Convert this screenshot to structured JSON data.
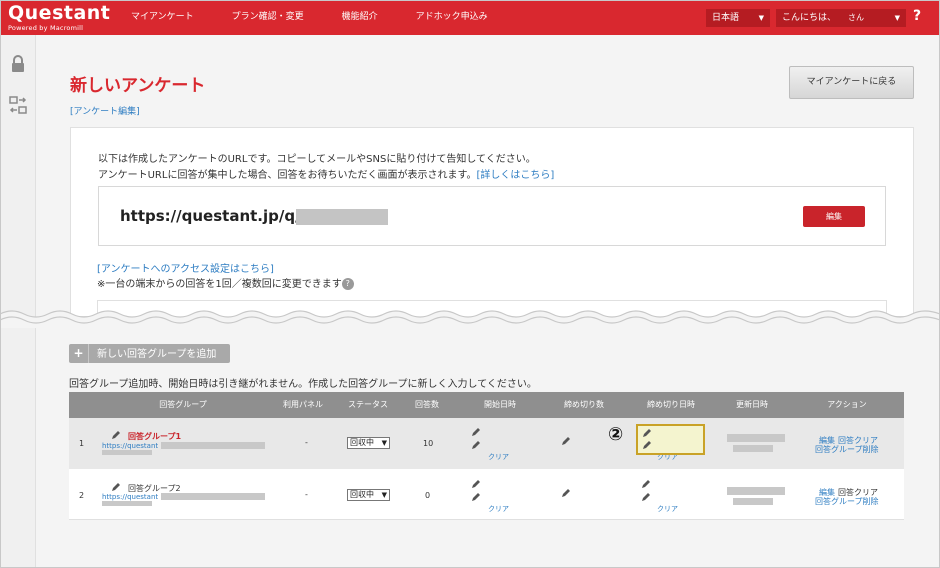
{
  "header": {
    "logo": "Questant",
    "logo_sub": "Powered by Macromill",
    "nav": [
      "マイアンケート",
      "プラン確認・変更",
      "機能紹介",
      "アドホック申込み"
    ],
    "language": "日本語",
    "greeting": "こんにちは、",
    "greeting_suffix": "さん",
    "help": "?"
  },
  "sidebar": {
    "icons": [
      "lock-icon",
      "transfer-icon"
    ]
  },
  "page": {
    "title": "新しいアンケート",
    "breadcrumb": "[アンケート編集]",
    "back_button": "マイアンケートに戻る"
  },
  "url_panel": {
    "desc_line1": "以下は作成したアンケートのURLです。コピーしてメールやSNSに貼り付けて告知してください。",
    "desc_line2": "アンケートURLに回答が集中した場合、回答をお待ちいただく画面が表示されます。",
    "details_link": "[詳しくはこちら]",
    "url": "https://questant.jp/q/",
    "edit_button": "編集",
    "access_link": "[アンケートへのアクセス設定はこちら]",
    "access_note": "※一台の端末からの回答を1回／複数回に変更できます"
  },
  "groups": {
    "add_button": "新しい回答グループを追加",
    "note": "回答グループ追加時、開始日時は引き継がれません。作成した回答グループに新しく入力してください。",
    "columns": [
      "回答グループ",
      "利用パネル",
      "ステータス",
      "回答数",
      "開始日時",
      "締め切り数",
      "締め切り日時",
      "更新日時",
      "アクション"
    ],
    "rows": [
      {
        "no": "1",
        "name": "回答グループ1",
        "url": "https://questant",
        "panel": "-",
        "status": "回収中",
        "count": "10",
        "clear_start": "クリア",
        "clear_end": "クリア",
        "action_edit": "編集",
        "action_clear": "回答クリア",
        "action_delete": "回答グループ削除"
      },
      {
        "no": "2",
        "name": "回答グループ2",
        "url": "https://questant",
        "panel": "-",
        "status": "回収中",
        "count": "0",
        "clear_start": "クリア",
        "clear_end": "クリア",
        "action_edit": "編集",
        "action_clear": "回答クリア",
        "action_delete": "回答グループ削除"
      }
    ]
  },
  "annotation": "②",
  "colors": {
    "brand": "#d9282f",
    "link": "#2e7dc2",
    "highlight_border": "#c9a227"
  }
}
